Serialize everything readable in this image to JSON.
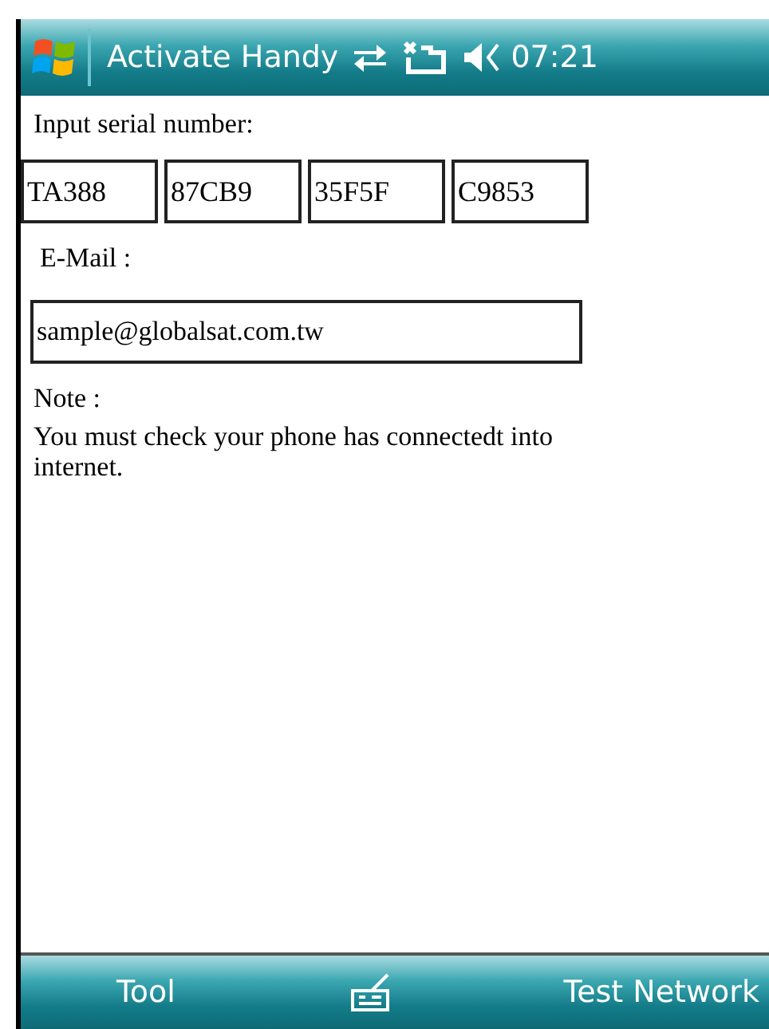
{
  "title_bar": {
    "title": "Activate Handy",
    "time": "07:21"
  },
  "serial": {
    "label": "Input serial number:",
    "parts": [
      "TA388",
      "87CB9",
      "35F5F",
      "C9853"
    ]
  },
  "email": {
    "label": "E-Mail :",
    "value": "sample@globalsat.com.tw"
  },
  "note": {
    "label": "Note :",
    "text": "You must check your phone has connectedt into internet."
  },
  "menu_bar": {
    "left": "Tool",
    "right": "Test Network"
  }
}
